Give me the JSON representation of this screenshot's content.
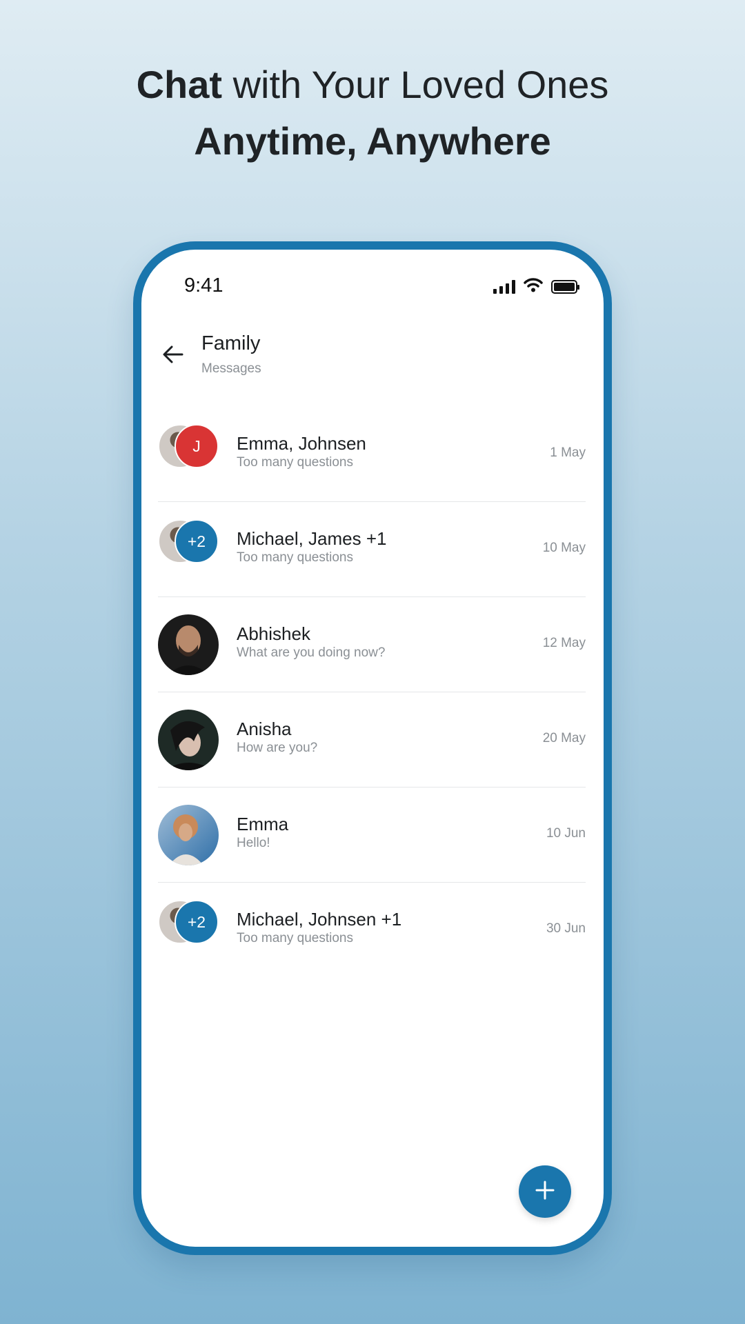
{
  "headline": {
    "line1_bold": "Chat",
    "line1_rest": " with Your Loved Ones",
    "line2": "Anytime, Anywhere"
  },
  "status_bar": {
    "time": "9:41"
  },
  "header": {
    "title": "Family",
    "subtitle": "Messages"
  },
  "chats": [
    {
      "name": "Emma, Johnsen",
      "preview": "Too many questions",
      "date": "1 May",
      "avatar_type": "group",
      "badge": "J",
      "badge_color": "#d93434"
    },
    {
      "name": "Michael, James +1",
      "preview": "Too many questions",
      "date": "10 May",
      "avatar_type": "group",
      "badge": "+2",
      "badge_color": "#1a76ad"
    },
    {
      "name": "Abhishek",
      "preview": "What are you doing now?",
      "date": "12 May",
      "avatar_type": "photo"
    },
    {
      "name": "Anisha",
      "preview": "How are you?",
      "date": "20 May",
      "avatar_type": "photo"
    },
    {
      "name": "Emma",
      "preview": "Hello!",
      "date": "10 Jun",
      "avatar_type": "photo"
    },
    {
      "name": "Michael, Johnsen +1",
      "preview": "Too many questions",
      "date": "30 Jun",
      "avatar_type": "group",
      "badge": "+2",
      "badge_color": "#1a76ad"
    }
  ],
  "colors": {
    "accent": "#1a76ad",
    "alert": "#d93434"
  },
  "icons": {
    "back": "arrow-left-icon",
    "add": "plus-icon",
    "signal": "signal-icon",
    "wifi": "wifi-icon",
    "battery": "battery-icon"
  }
}
